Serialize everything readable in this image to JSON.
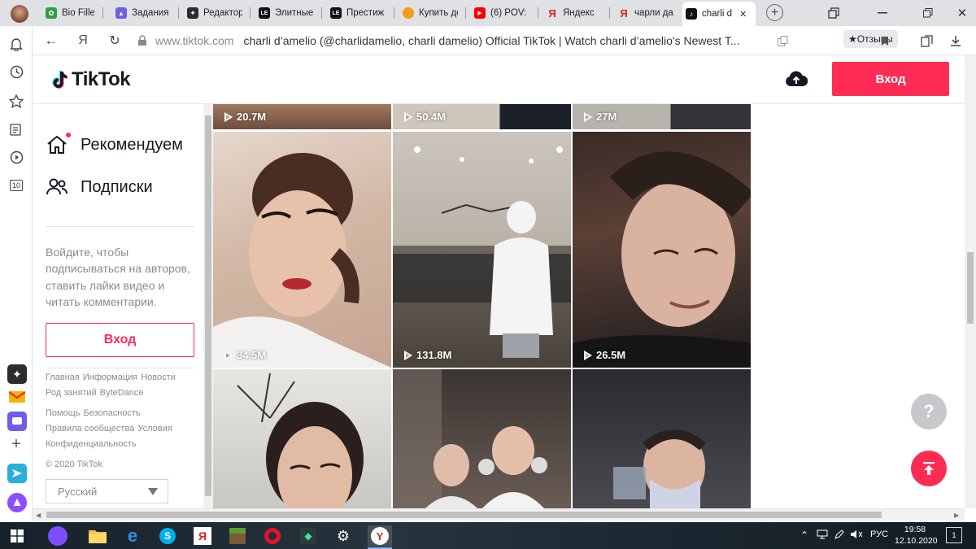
{
  "browser": {
    "tabs": [
      {
        "label": "Bio Filler",
        "icon": "leaf-icon",
        "color": "#2e9d3f",
        "glyph": "✿"
      },
      {
        "label": "Задания",
        "icon": "triangle-icon",
        "color": "#6f5ee8",
        "glyph": "▲"
      },
      {
        "label": "Редактор",
        "icon": "sparkle-icon",
        "color": "#2b2b2b",
        "glyph": "✦"
      },
      {
        "label": "Элитные",
        "icon": "le-logo-icon",
        "color": "#111111",
        "glyph": "LE"
      },
      {
        "label": "Престиж",
        "icon": "le-logo-icon",
        "color": "#111111",
        "glyph": "LE"
      },
      {
        "label": "Купить до",
        "icon": "orange-circle-icon",
        "color": "#f59a1b",
        "glyph": ""
      },
      {
        "label": "(6) POV: ",
        "icon": "youtube-icon",
        "color": "#ff0000",
        "glyph": "▶"
      },
      {
        "label": "Яндекс",
        "icon": "yandex-icon",
        "color": "#ffffff",
        "glyph": "Я"
      },
      {
        "label": "чарли да",
        "icon": "yandex-icon",
        "color": "#ffffff",
        "glyph": "Я"
      },
      {
        "label": "charli d",
        "icon": "tiktok-icon",
        "color": "#111111",
        "glyph": "♪",
        "active": true
      }
    ],
    "close_glyph": "✕",
    "new_tab_glyph": "+",
    "back_glyph": "←",
    "yandex_glyph": "Я",
    "reload_glyph": "↻",
    "domain": "www.tiktok.com",
    "page_title": "charli d’amelio (@charlidamelio, charli damelio) Official TikTok | Watch charli d’amelio's Newest T...",
    "reviews_label": "★Отзывы",
    "sidebar_badge": "10"
  },
  "header": {
    "logo_text": "TikTok",
    "login_label": "Вход",
    "upload_icon": "upload-cloud-icon"
  },
  "nav": {
    "items": [
      {
        "label": "Рекомендуем",
        "icon": "home-icon",
        "has_dot": true
      },
      {
        "label": "Подписки",
        "icon": "people-icon",
        "has_dot": false
      }
    ],
    "login_hint": "Войдите, чтобы подписываться на авторов, ставить лайки видео и читать комментарии.",
    "login_label": "Вход",
    "footer_links_1": [
      "Главная",
      "Информация",
      "Новости",
      "Род занятий",
      "ByteDance"
    ],
    "footer_links_2": [
      "Помощь",
      "Безопасность",
      "Правила сообщества",
      "Условия",
      "Конфиденциальность"
    ],
    "copyright": "© 2020 TikTok",
    "language": "Русский"
  },
  "videos": [
    {
      "views": "20.7M"
    },
    {
      "views": "50.4M"
    },
    {
      "views": "27M"
    },
    {
      "views": "34.5M"
    },
    {
      "views": "131.8M"
    },
    {
      "views": "26.5M"
    },
    {
      "views": ""
    },
    {
      "views": ""
    },
    {
      "views": ""
    }
  ],
  "floating": {
    "help_label": "?"
  },
  "taskbar": {
    "language": "РУС",
    "time": "19:58",
    "date": "12.10.2020",
    "notifications": "1",
    "tray_up_glyph": "⌃"
  },
  "colors": {
    "accent": "#fe2c55",
    "text": "#161823",
    "muted": "#8a8b91"
  }
}
